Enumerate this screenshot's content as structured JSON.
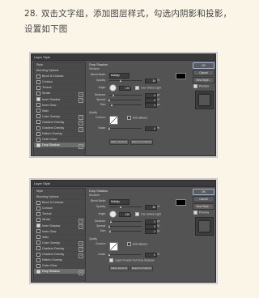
{
  "caption": "28. 双击文字组，添加图层样式，勾选内阴影和投影，设置如下图",
  "dialogs": [
    {
      "title": "Layer Style",
      "styles": [
        {
          "label": "Style",
          "checked": null,
          "plus": false,
          "selected": false
        },
        {
          "label": "Blending Options",
          "checked": null,
          "plus": false,
          "selected": false
        },
        {
          "label": "Bevel & Emboss",
          "checked": false,
          "plus": false,
          "selected": false
        },
        {
          "label": "Contour",
          "checked": false,
          "plus": false,
          "selected": false
        },
        {
          "label": "Texture",
          "checked": false,
          "plus": false,
          "selected": false
        },
        {
          "label": "Stroke",
          "checked": false,
          "plus": true,
          "selected": false
        },
        {
          "label": "Inner Shadow",
          "checked": true,
          "plus": true,
          "selected": false
        },
        {
          "label": "Inner Glow",
          "checked": false,
          "plus": false,
          "selected": false
        },
        {
          "label": "Satin",
          "checked": false,
          "plus": false,
          "selected": false
        },
        {
          "label": "Color Overlay",
          "checked": false,
          "plus": true,
          "selected": false
        },
        {
          "label": "Gradient Overlay",
          "checked": false,
          "plus": true,
          "selected": false
        },
        {
          "label": "Gradient Overlay",
          "checked": false,
          "plus": true,
          "selected": false
        },
        {
          "label": "Pattern Overlay",
          "checked": false,
          "plus": false,
          "selected": false
        },
        {
          "label": "Outer Glow",
          "checked": false,
          "plus": false,
          "selected": false
        },
        {
          "label": "Drop Shadow",
          "checked": true,
          "plus": true,
          "selected": true
        }
      ],
      "section": "Drop Shadow",
      "structure": "Structure",
      "blend_mode_label": "Blend Mode:",
      "blend_mode": "Multiply",
      "opacity_label": "Opacity:",
      "opacity": "35",
      "angle_label": "Angle:",
      "angle": "120",
      "global_light": "Use Global Light",
      "distance_label": "Distance:",
      "distance": "4",
      "spread_label": "Spread:",
      "spread": "0",
      "size_label": "Size:",
      "size": "4",
      "quality": "Quality",
      "contour_label": "Contour:",
      "antialiased": "Anti-aliased",
      "noise_label": "Noise:",
      "noise": "0",
      "knockout": "",
      "make_default": "Make Default",
      "reset_default": "Reset to Default",
      "ok": "OK",
      "cancel": "Cancel",
      "new_style": "New Style...",
      "preview": "Preview",
      "unit_px": "px",
      "unit_pct": "%",
      "degree": "°"
    },
    {
      "title": "Layer Style",
      "styles": [
        {
          "label": "Style",
          "checked": null,
          "plus": false,
          "selected": false
        },
        {
          "label": "Blending Options",
          "checked": null,
          "plus": false,
          "selected": false
        },
        {
          "label": "Bevel & Emboss",
          "checked": false,
          "plus": false,
          "selected": false
        },
        {
          "label": "Contour",
          "checked": false,
          "plus": false,
          "selected": false
        },
        {
          "label": "Texture",
          "checked": false,
          "plus": false,
          "selected": false
        },
        {
          "label": "Stroke",
          "checked": false,
          "plus": true,
          "selected": false
        },
        {
          "label": "Inner Shadow",
          "checked": true,
          "plus": true,
          "selected": false
        },
        {
          "label": "Inner Glow",
          "checked": false,
          "plus": false,
          "selected": false
        },
        {
          "label": "Satin",
          "checked": false,
          "plus": false,
          "selected": false
        },
        {
          "label": "Color Overlay",
          "checked": false,
          "plus": true,
          "selected": false
        },
        {
          "label": "Gradient Overlay",
          "checked": false,
          "plus": true,
          "selected": false
        },
        {
          "label": "Gradient Overlay",
          "checked": false,
          "plus": true,
          "selected": false
        },
        {
          "label": "Pattern Overlay",
          "checked": false,
          "plus": false,
          "selected": false
        },
        {
          "label": "Outer Glow",
          "checked": false,
          "plus": false,
          "selected": false
        },
        {
          "label": "Drop Shadow",
          "checked": true,
          "plus": true,
          "selected": true
        }
      ],
      "section": "Drop Shadow",
      "structure": "Structure",
      "blend_mode_label": "Blend Mode:",
      "blend_mode": "Multiply",
      "opacity_label": "Opacity:",
      "opacity": "35",
      "angle_label": "Angle:",
      "angle": "120",
      "global_light": "Use Global Light",
      "distance_label": "Distance:",
      "distance": "2",
      "spread_label": "Spread:",
      "spread": "0",
      "size_label": "Size:",
      "size": "2",
      "quality": "Quality",
      "contour_label": "Contour:",
      "antialiased": "Anti-aliased",
      "noise_label": "Noise:",
      "noise": "0",
      "knockout": "Layer Knocks Out Drop Shadow",
      "make_default": "Make Default",
      "reset_default": "Reset to Default",
      "ok": "OK",
      "cancel": "Cancel",
      "new_style": "New Style...",
      "preview": "Preview",
      "unit_px": "px",
      "unit_pct": "%",
      "degree": "°"
    }
  ]
}
